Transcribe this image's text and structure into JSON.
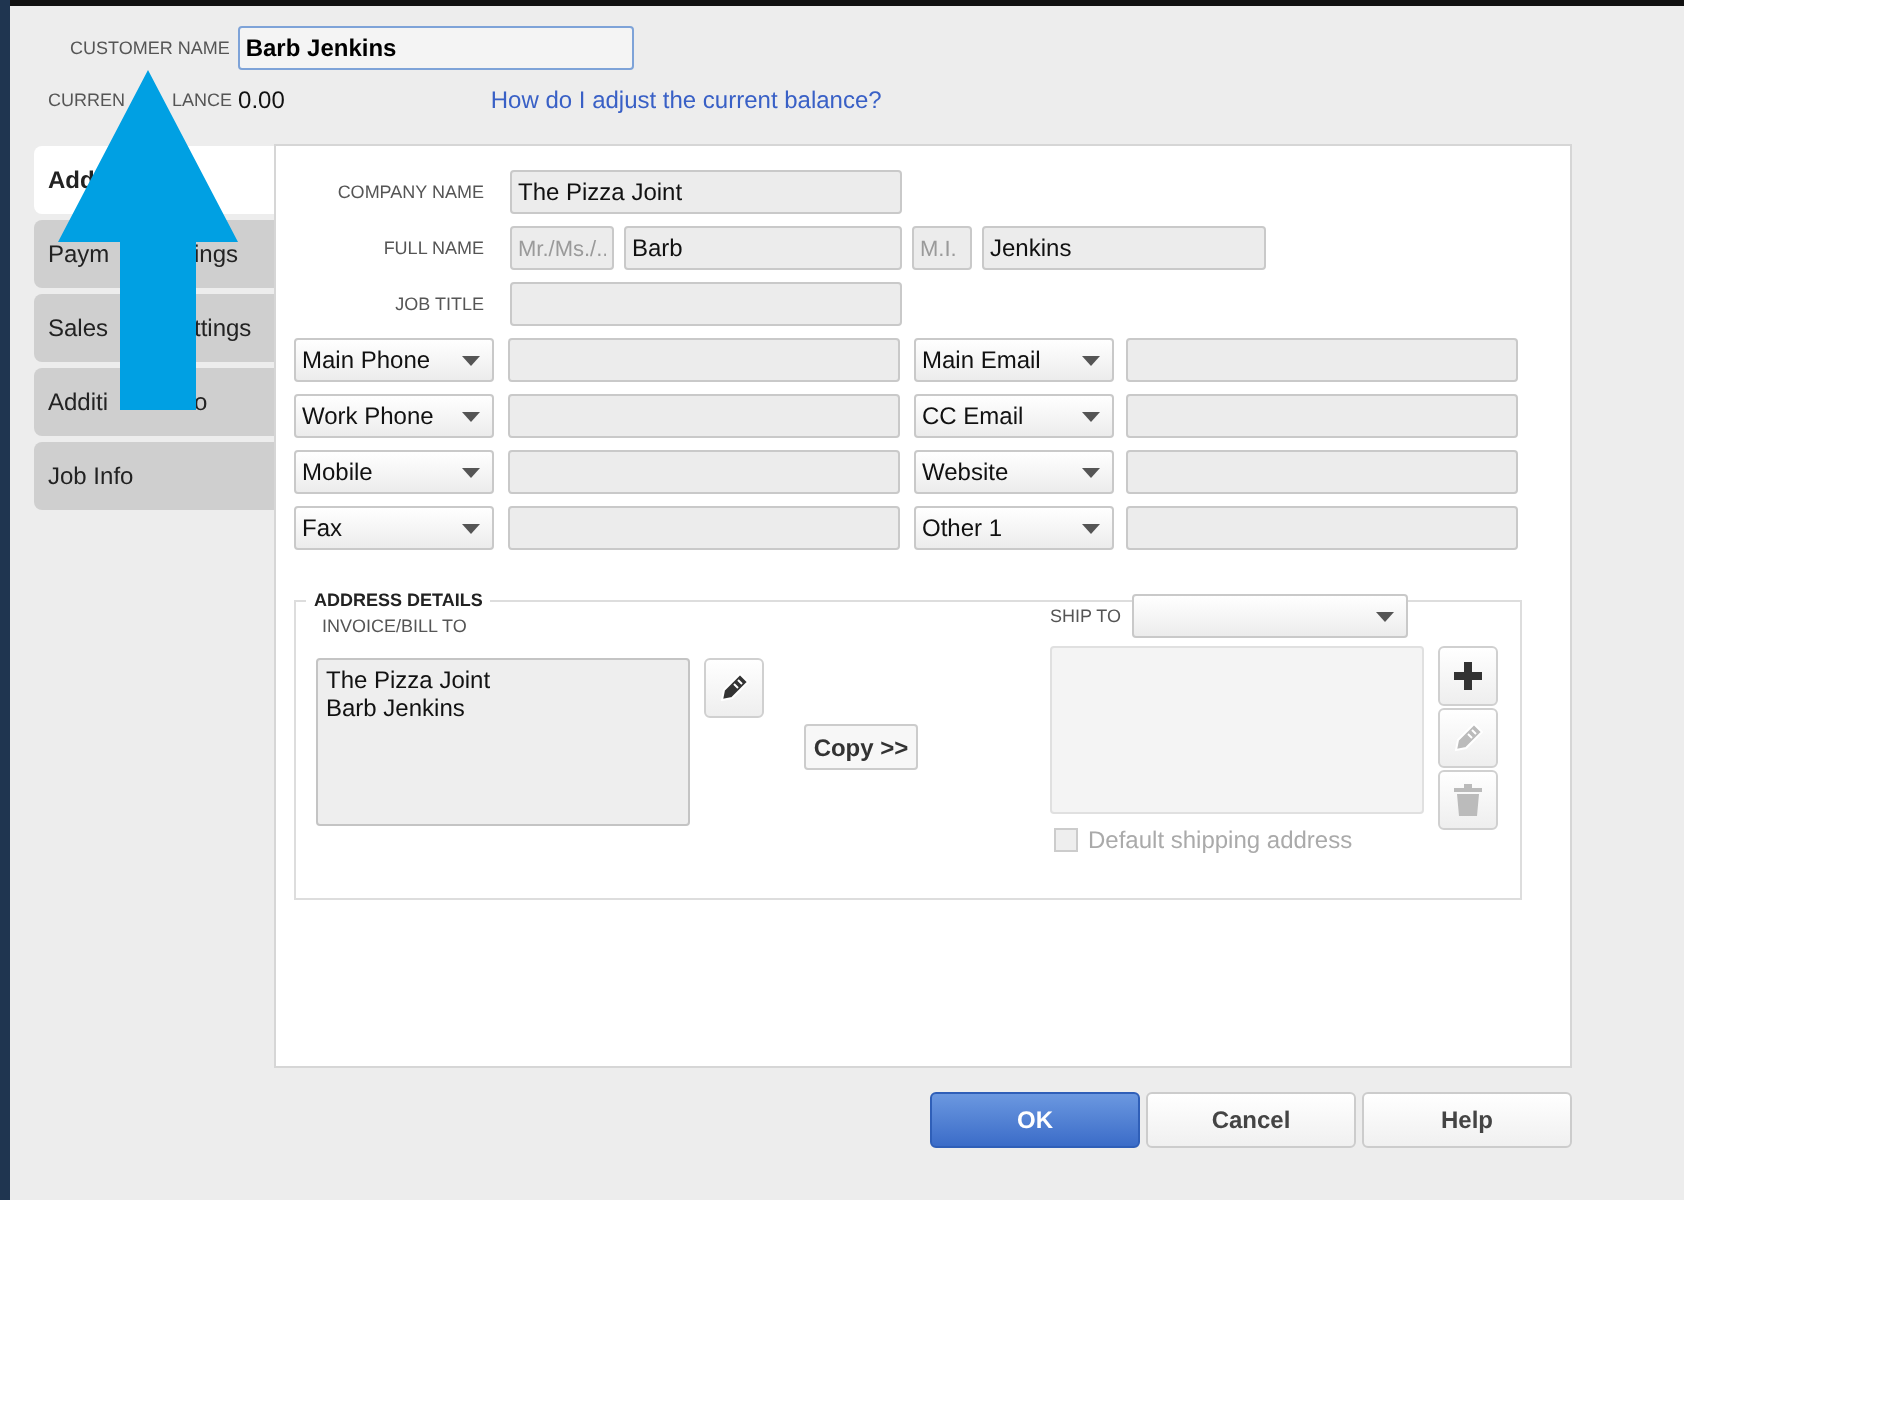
{
  "customer_name": {
    "label": "CUSTOMER NAME",
    "value": "Barb Jenkins"
  },
  "current_balance": {
    "label_parts": [
      "CURREN",
      "LANCE"
    ],
    "value": "0.00"
  },
  "balance_link": "How do I adjust the current balance?",
  "tabs": [
    {
      "label_parts": [
        "Add"
      ],
      "selected": true
    },
    {
      "label_parts": [
        "Paym",
        "ings"
      ],
      "selected": false
    },
    {
      "label_parts": [
        "Sales",
        "ttings"
      ],
      "selected": false
    },
    {
      "label_parts": [
        "Additi",
        "o"
      ],
      "selected": false
    },
    {
      "label_parts": [
        "Job Info"
      ],
      "selected": false
    }
  ],
  "company_name": {
    "label": "COMPANY NAME",
    "value": "The Pizza Joint"
  },
  "full_name": {
    "label": "FULL NAME",
    "title_placeholder": "Mr./Ms./..",
    "first": "Barb",
    "mi_placeholder": "M.I.",
    "last": "Jenkins"
  },
  "job_title": {
    "label": "JOB TITLE"
  },
  "contacts_left": [
    {
      "type": "Main Phone"
    },
    {
      "type": "Work Phone"
    },
    {
      "type": "Mobile"
    },
    {
      "type": "Fax"
    }
  ],
  "contacts_right": [
    {
      "type": "Main Email"
    },
    {
      "type": "CC Email"
    },
    {
      "type": "Website"
    },
    {
      "type": "Other 1"
    }
  ],
  "address": {
    "legend": "ADDRESS DETAILS",
    "bill_label": "INVOICE/BILL TO",
    "bill_lines": [
      "The Pizza Joint",
      "Barb Jenkins"
    ],
    "copy": "Copy >>",
    "ship_label": "SHIP TO",
    "ship_tools": [
      {
        "kind": "add",
        "disabled": false
      },
      {
        "kind": "edit",
        "disabled": true
      },
      {
        "kind": "delete",
        "disabled": true
      }
    ],
    "default_shipping": {
      "label": "Default shipping address",
      "checked": false,
      "disabled": true
    }
  },
  "buttons": [
    {
      "label": "OK",
      "primary": true
    },
    {
      "label": "Cancel",
      "primary": false
    },
    {
      "label": "Help",
      "primary": false
    }
  ]
}
